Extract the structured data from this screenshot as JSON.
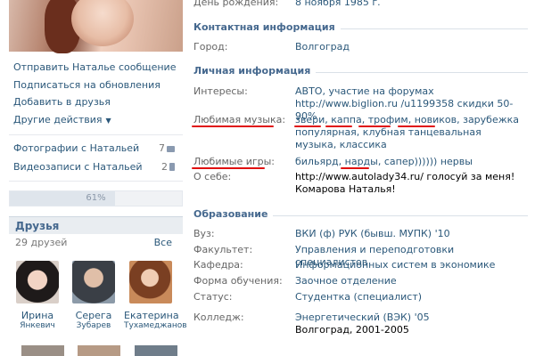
{
  "profile": {
    "actions": [
      {
        "label": "Отправить Наталье сообщение"
      },
      {
        "label": "Подписаться на обновления"
      },
      {
        "label": "Добавить в друзья"
      },
      {
        "label": "Другие действия",
        "arrow": "▼"
      }
    ],
    "media": [
      {
        "label": "Фотографии с Натальей",
        "count": "7"
      },
      {
        "label": "Видеозаписи с Натальей",
        "count": "2"
      }
    ],
    "completeness": {
      "text": "61%",
      "value": 61
    }
  },
  "friends": {
    "title": "Друзья",
    "count_text": "29 друзей",
    "all_label": "Все",
    "items": [
      {
        "first": "Ирина",
        "last": "Янкевич"
      },
      {
        "first": "Серега",
        "last": "Зубарев"
      },
      {
        "first": "Екатерина",
        "last": "Тухамеджанов"
      }
    ]
  },
  "info": {
    "birthday": {
      "label": "День рождения:",
      "value": "8 ноября 1985 г."
    },
    "contact": {
      "title": "Контактная информация",
      "city": {
        "label": "Город:",
        "value": "Волгоград"
      }
    },
    "personal": {
      "title": "Личная информация",
      "interests": {
        "label": "Интересы:",
        "value": "АВТО, участие на форумах http://www.biglion.ru /u1199358 скидки 50-90%"
      },
      "music": {
        "label": "Любимая музыка:",
        "value": "звери, каппа, трофим, новиков, зарубежка популярная, клубная танцевальная музыка, классика"
      },
      "games": {
        "label": "Любимые игры:",
        "value": "бильярд, нарды, сапер)))))) нервы"
      },
      "about": {
        "label": "О себе:",
        "value": "http://www.autolady34.ru/ голосуй за меня! Комарова Наталья!"
      }
    },
    "education": {
      "title": "Образование",
      "university": {
        "label": "Вуз:",
        "value": "ВКИ (ф) РУК (бывш. МУПК) '10"
      },
      "faculty": {
        "label": "Факультет:",
        "value": "Управления и переподготовки специалистов"
      },
      "chair": {
        "label": "Кафедра:",
        "value": "Информационных систем в экономике"
      },
      "form": {
        "label": "Форма обучения:",
        "value": "Заочное отделение"
      },
      "status": {
        "label": "Статус:",
        "value": "Студентка (специалист)"
      },
      "college": {
        "label": "Колледж:",
        "value": "Энергетический (ВЭК) '05",
        "detail": "Волгоград, 2001-2005"
      }
    }
  },
  "colors": {
    "link": "#2b587a",
    "header": "#45688e",
    "annotation": "#e01010"
  }
}
